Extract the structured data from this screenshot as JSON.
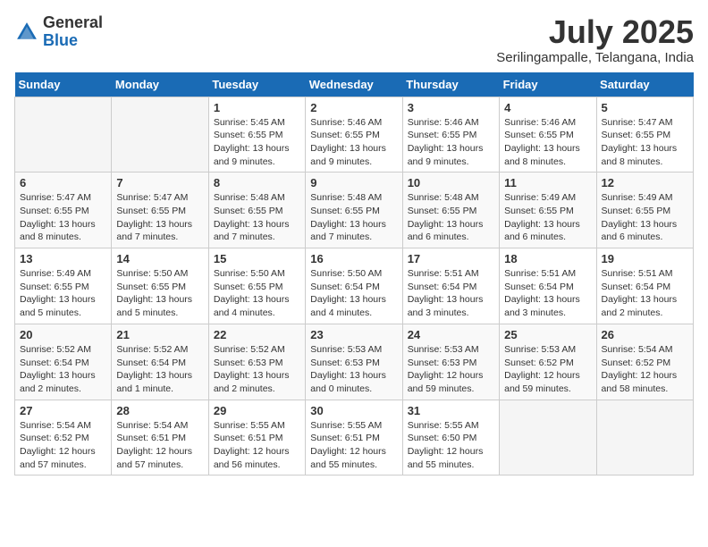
{
  "header": {
    "logo_general": "General",
    "logo_blue": "Blue",
    "month_year": "July 2025",
    "location": "Serilingampalle, Telangana, India"
  },
  "days_of_week": [
    "Sunday",
    "Monday",
    "Tuesday",
    "Wednesday",
    "Thursday",
    "Friday",
    "Saturday"
  ],
  "weeks": [
    [
      {
        "day": "",
        "info": ""
      },
      {
        "day": "",
        "info": ""
      },
      {
        "day": "1",
        "info": "Sunrise: 5:45 AM\nSunset: 6:55 PM\nDaylight: 13 hours and 9 minutes."
      },
      {
        "day": "2",
        "info": "Sunrise: 5:46 AM\nSunset: 6:55 PM\nDaylight: 13 hours and 9 minutes."
      },
      {
        "day": "3",
        "info": "Sunrise: 5:46 AM\nSunset: 6:55 PM\nDaylight: 13 hours and 9 minutes."
      },
      {
        "day": "4",
        "info": "Sunrise: 5:46 AM\nSunset: 6:55 PM\nDaylight: 13 hours and 8 minutes."
      },
      {
        "day": "5",
        "info": "Sunrise: 5:47 AM\nSunset: 6:55 PM\nDaylight: 13 hours and 8 minutes."
      }
    ],
    [
      {
        "day": "6",
        "info": "Sunrise: 5:47 AM\nSunset: 6:55 PM\nDaylight: 13 hours and 8 minutes."
      },
      {
        "day": "7",
        "info": "Sunrise: 5:47 AM\nSunset: 6:55 PM\nDaylight: 13 hours and 7 minutes."
      },
      {
        "day": "8",
        "info": "Sunrise: 5:48 AM\nSunset: 6:55 PM\nDaylight: 13 hours and 7 minutes."
      },
      {
        "day": "9",
        "info": "Sunrise: 5:48 AM\nSunset: 6:55 PM\nDaylight: 13 hours and 7 minutes."
      },
      {
        "day": "10",
        "info": "Sunrise: 5:48 AM\nSunset: 6:55 PM\nDaylight: 13 hours and 6 minutes."
      },
      {
        "day": "11",
        "info": "Sunrise: 5:49 AM\nSunset: 6:55 PM\nDaylight: 13 hours and 6 minutes."
      },
      {
        "day": "12",
        "info": "Sunrise: 5:49 AM\nSunset: 6:55 PM\nDaylight: 13 hours and 6 minutes."
      }
    ],
    [
      {
        "day": "13",
        "info": "Sunrise: 5:49 AM\nSunset: 6:55 PM\nDaylight: 13 hours and 5 minutes."
      },
      {
        "day": "14",
        "info": "Sunrise: 5:50 AM\nSunset: 6:55 PM\nDaylight: 13 hours and 5 minutes."
      },
      {
        "day": "15",
        "info": "Sunrise: 5:50 AM\nSunset: 6:55 PM\nDaylight: 13 hours and 4 minutes."
      },
      {
        "day": "16",
        "info": "Sunrise: 5:50 AM\nSunset: 6:54 PM\nDaylight: 13 hours and 4 minutes."
      },
      {
        "day": "17",
        "info": "Sunrise: 5:51 AM\nSunset: 6:54 PM\nDaylight: 13 hours and 3 minutes."
      },
      {
        "day": "18",
        "info": "Sunrise: 5:51 AM\nSunset: 6:54 PM\nDaylight: 13 hours and 3 minutes."
      },
      {
        "day": "19",
        "info": "Sunrise: 5:51 AM\nSunset: 6:54 PM\nDaylight: 13 hours and 2 minutes."
      }
    ],
    [
      {
        "day": "20",
        "info": "Sunrise: 5:52 AM\nSunset: 6:54 PM\nDaylight: 13 hours and 2 minutes."
      },
      {
        "day": "21",
        "info": "Sunrise: 5:52 AM\nSunset: 6:54 PM\nDaylight: 13 hours and 1 minute."
      },
      {
        "day": "22",
        "info": "Sunrise: 5:52 AM\nSunset: 6:53 PM\nDaylight: 13 hours and 2 minutes."
      },
      {
        "day": "23",
        "info": "Sunrise: 5:53 AM\nSunset: 6:53 PM\nDaylight: 13 hours and 0 minutes."
      },
      {
        "day": "24",
        "info": "Sunrise: 5:53 AM\nSunset: 6:53 PM\nDaylight: 12 hours and 59 minutes."
      },
      {
        "day": "25",
        "info": "Sunrise: 5:53 AM\nSunset: 6:52 PM\nDaylight: 12 hours and 59 minutes."
      },
      {
        "day": "26",
        "info": "Sunrise: 5:54 AM\nSunset: 6:52 PM\nDaylight: 12 hours and 58 minutes."
      }
    ],
    [
      {
        "day": "27",
        "info": "Sunrise: 5:54 AM\nSunset: 6:52 PM\nDaylight: 12 hours and 57 minutes."
      },
      {
        "day": "28",
        "info": "Sunrise: 5:54 AM\nSunset: 6:51 PM\nDaylight: 12 hours and 57 minutes."
      },
      {
        "day": "29",
        "info": "Sunrise: 5:55 AM\nSunset: 6:51 PM\nDaylight: 12 hours and 56 minutes."
      },
      {
        "day": "30",
        "info": "Sunrise: 5:55 AM\nSunset: 6:51 PM\nDaylight: 12 hours and 55 minutes."
      },
      {
        "day": "31",
        "info": "Sunrise: 5:55 AM\nSunset: 6:50 PM\nDaylight: 12 hours and 55 minutes."
      },
      {
        "day": "",
        "info": ""
      },
      {
        "day": "",
        "info": ""
      }
    ]
  ]
}
